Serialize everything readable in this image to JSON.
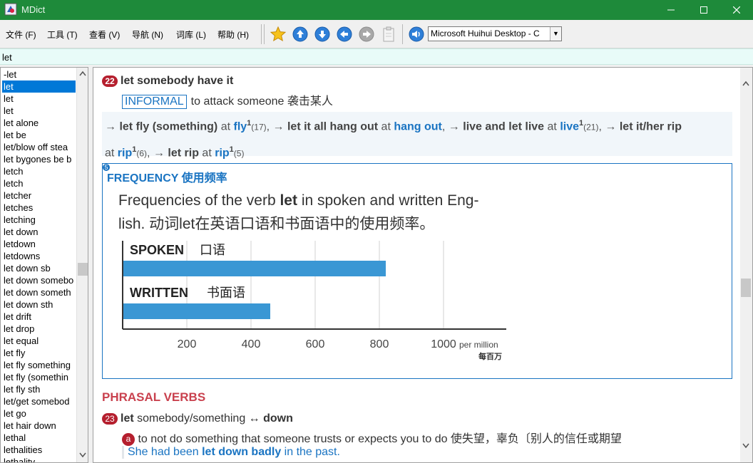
{
  "window": {
    "title": "MDict"
  },
  "menu": [
    "文件 (F)",
    "工具 (T)",
    "查看 (V)",
    "导航 (N)",
    "词库 (L)",
    "帮助 (H)"
  ],
  "toolbar": {
    "dictionary_select": "Microsoft Huihui Desktop - C"
  },
  "search": {
    "value": "let"
  },
  "wordlist": [
    "-let",
    "let",
    "let",
    "let",
    "let alone",
    "let be",
    "let/blow off stea",
    "let bygones be b",
    "letch",
    "letch",
    "letcher",
    "letches",
    "letching",
    "let down",
    "letdown",
    "letdowns",
    "let down sb",
    "let down somebo",
    "let down someth",
    "let down sth",
    "let drift",
    "let drop",
    "let equal",
    "let fly",
    "let fly something",
    "let fly (somethin",
    "let fly sth",
    "let/get somebod",
    "let go",
    "let hair down",
    "lethal",
    "lethalities",
    "lethality"
  ],
  "entry22": {
    "num": "22",
    "phrase_bold": "let",
    "phrase_rest": "somebody have it",
    "register": "INFORMAL",
    "definition": "to attack someone 袭击某人"
  },
  "xref": {
    "arrow": "→",
    "items": [
      {
        "phrase": "let fly (something)",
        "at": "at",
        "link": "fly",
        "sup": "1",
        "count": "(17)",
        "sep": ","
      },
      {
        "phrase": "let it all hang out",
        "at": "at",
        "link": "hang out",
        "sup": "",
        "count": "",
        "sep": ","
      },
      {
        "phrase": "live and let live",
        "at": "at",
        "link": "live",
        "sup": "1",
        "count": "(21)",
        "sep": ","
      },
      {
        "phrase": "let it/her rip",
        "at": "at",
        "link": "rip",
        "sup": "1",
        "count": "(6)",
        "sep": ","
      },
      {
        "phrase": "let rip",
        "at": "at",
        "link": "rip",
        "sup": "1",
        "count": "(5)",
        "sep": ""
      }
    ]
  },
  "frequency": {
    "corner_badge": "5",
    "title": "FREQUENCY 使用频率",
    "caption_line1_pre": "Frequencies of the verb ",
    "caption_line1_bold": "let",
    "caption_line1_post": " in spoken and written Eng-",
    "caption_line2": "lish. 动词let在英语口语和书面语中的使用频率。",
    "unit": "per million",
    "unit_cn": "每百万"
  },
  "chart_data": {
    "type": "bar",
    "orientation": "horizontal",
    "categories": [
      "SPOKEN 口语",
      "WRITTEN 书面语"
    ],
    "values": [
      820,
      460
    ],
    "xlim": [
      0,
      1100
    ],
    "xticks": [
      200,
      400,
      600,
      800,
      1000
    ],
    "xlabel": "per million 每百万",
    "grid": true,
    "bar_color": "#3a97d4"
  },
  "phrasal_verbs": {
    "heading": "PHRASAL VERBS"
  },
  "entry23": {
    "num": "23",
    "head_bold": "let",
    "head_rest": "somebody/something",
    "arrow": "↔",
    "particle": "down",
    "sense_letter": "a",
    "definition": "to not do something that someone trusts or expects you to do 使失望，辜负〔别人的信任或期望",
    "example_pre": "She had been ",
    "example_bold": "let down badly",
    "example_post": " in the past."
  }
}
